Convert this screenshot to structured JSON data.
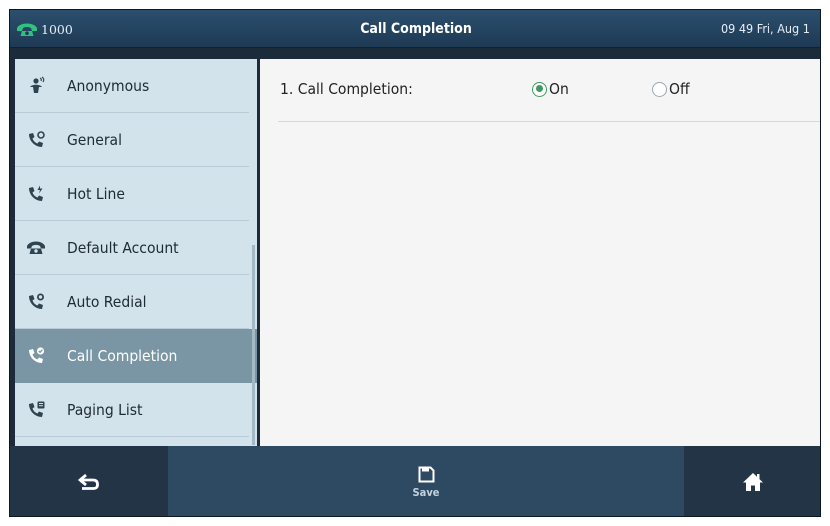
{
  "topbar": {
    "account": "1000",
    "title": "Call Completion",
    "clock": "09 49 Fri, Aug 1",
    "account_icon": "phone-handset-icon",
    "accent_color": "#2ec27e"
  },
  "sidebar": {
    "items": [
      {
        "label": "Anonymous",
        "icon": "anonymous-icon",
        "active": false
      },
      {
        "label": "General",
        "icon": "phone-settings-icon",
        "active": false
      },
      {
        "label": "Hot Line",
        "icon": "hotline-icon",
        "active": false
      },
      {
        "label": "Default Account",
        "icon": "desk-phone-icon",
        "active": false
      },
      {
        "label": "Auto Redial",
        "icon": "auto-redial-icon",
        "active": false
      },
      {
        "label": "Call Completion",
        "icon": "call-completion-icon",
        "active": true
      },
      {
        "label": "Paging List",
        "icon": "paging-list-icon",
        "active": false
      }
    ],
    "active_color": "#7a95a4"
  },
  "main": {
    "option_label": "1. Call Completion:",
    "option_on": "On",
    "option_off": "Off",
    "selected": "On"
  },
  "bottombar": {
    "back_icon": "back-icon",
    "save_label": "Save",
    "save_icon": "save-icon",
    "home_icon": "home-icon"
  }
}
